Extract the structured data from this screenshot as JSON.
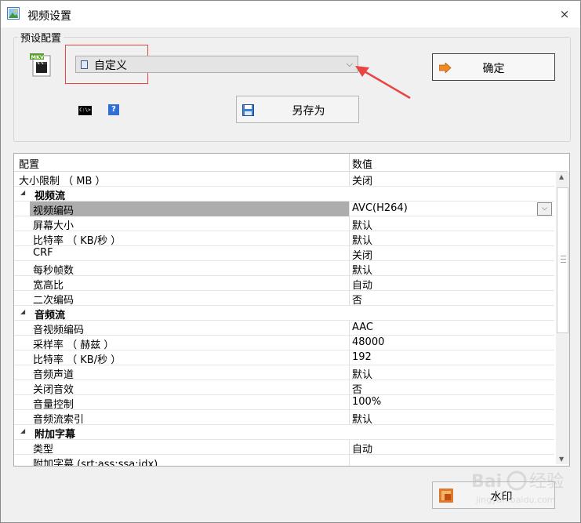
{
  "window": {
    "title": "视频设置",
    "close_glyph": "×",
    "app_icon": "settings-picture-icon"
  },
  "preset": {
    "group_label": "预设配置",
    "selected": "自定义",
    "format_icon": "mkv-file-icon",
    "format_icon_text": "MKV"
  },
  "buttons": {
    "ok": "确定",
    "save_as": "另存为",
    "watermark": "水印"
  },
  "toolbar_icons": {
    "cmd_text": "C:\\>",
    "help_text": "?"
  },
  "grid": {
    "headers": {
      "name": "配置",
      "value": "数值"
    },
    "rows": [
      {
        "kind": "top",
        "name": "大小限制 （ MB ）",
        "value": "关闭"
      },
      {
        "kind": "category",
        "name": "视频流"
      },
      {
        "kind": "item",
        "name": "视频编码",
        "value": "AVC(H264)",
        "selected": true,
        "dropdown": true
      },
      {
        "kind": "item",
        "name": "屏幕大小",
        "value": "默认"
      },
      {
        "kind": "item",
        "name": "比特率 （ KB/秒 ）",
        "value": "默认"
      },
      {
        "kind": "item",
        "name": "CRF",
        "value": "关闭"
      },
      {
        "kind": "item",
        "name": "每秒帧数",
        "value": "默认"
      },
      {
        "kind": "item",
        "name": "宽高比",
        "value": "自动"
      },
      {
        "kind": "item",
        "name": "二次编码",
        "value": "否"
      },
      {
        "kind": "category",
        "name": "音频流"
      },
      {
        "kind": "item",
        "name": "音视频编码",
        "value": "AAC"
      },
      {
        "kind": "item",
        "name": "采样率 （ 赫兹 ）",
        "value": "48000"
      },
      {
        "kind": "item",
        "name": "比特率 （ KB/秒 ）",
        "value": "192"
      },
      {
        "kind": "item",
        "name": "音频声道",
        "value": "默认"
      },
      {
        "kind": "item",
        "name": "关闭音效",
        "value": "否"
      },
      {
        "kind": "item",
        "name": "音量控制",
        "value": "100%"
      },
      {
        "kind": "item",
        "name": "音频流索引",
        "value": "默认"
      },
      {
        "kind": "category",
        "name": "附加字幕"
      },
      {
        "kind": "item",
        "name": "类型",
        "value": "自动"
      },
      {
        "kind": "item",
        "name": "附加字幕 (srt;ass;ssa;idx)",
        "value": ""
      }
    ]
  },
  "watermark_overlay": {
    "brand": "Bai",
    "text": "经验",
    "url": "jingyan.baidu.com"
  },
  "colors": {
    "highlight_box": "#e84444",
    "annotation_arrow": "#e84444",
    "selected_row": "#adadad"
  }
}
